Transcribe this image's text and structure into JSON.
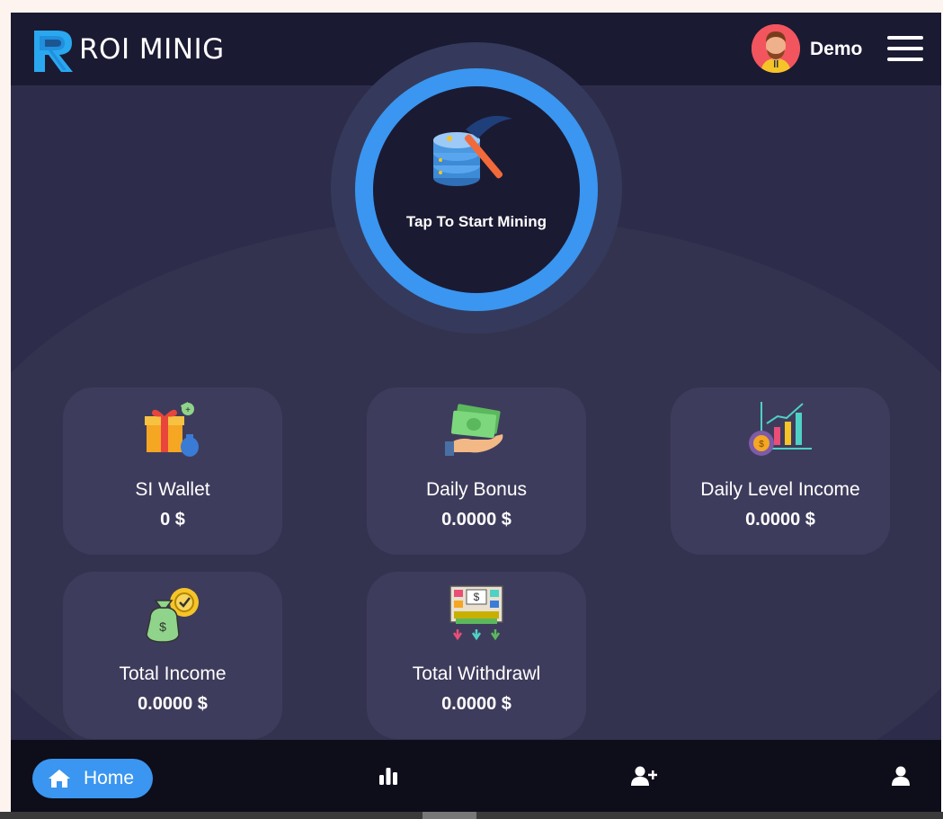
{
  "header": {
    "brand": "ROI MINIG",
    "user_name": "Demo",
    "avatar": "user-avatar",
    "menu_icon": "hamburger-menu-icon"
  },
  "mining": {
    "label": "Tap To Start Mining",
    "icon": "server-pickaxe-icon",
    "ring_color": "#3a96f0"
  },
  "cards": [
    {
      "title": "SI Wallet",
      "value": "0 $",
      "icon": "gift-wallet-icon"
    },
    {
      "title": "Daily Bonus",
      "value": "0.0000 $",
      "icon": "hand-money-icon"
    },
    {
      "title": "Daily Level Income",
      "value": "0.0000 $",
      "icon": "growth-chart-icon"
    },
    {
      "title": "Total Income",
      "value": "0.0000 $",
      "icon": "money-bag-icon"
    },
    {
      "title": "Total Withdrawl",
      "value": "0.0000 $",
      "icon": "atm-withdraw-icon"
    }
  ],
  "nav": {
    "home_label": "Home",
    "items": [
      "home-icon",
      "bar-chart-icon",
      "add-user-icon",
      "user-icon"
    ]
  },
  "colors": {
    "header_bg": "#1b1a33",
    "page_bg": "#2e2c4b",
    "card_bg": "#3e3c5c",
    "accent": "#3a96f0",
    "nav_bg": "#0e0d1a"
  }
}
